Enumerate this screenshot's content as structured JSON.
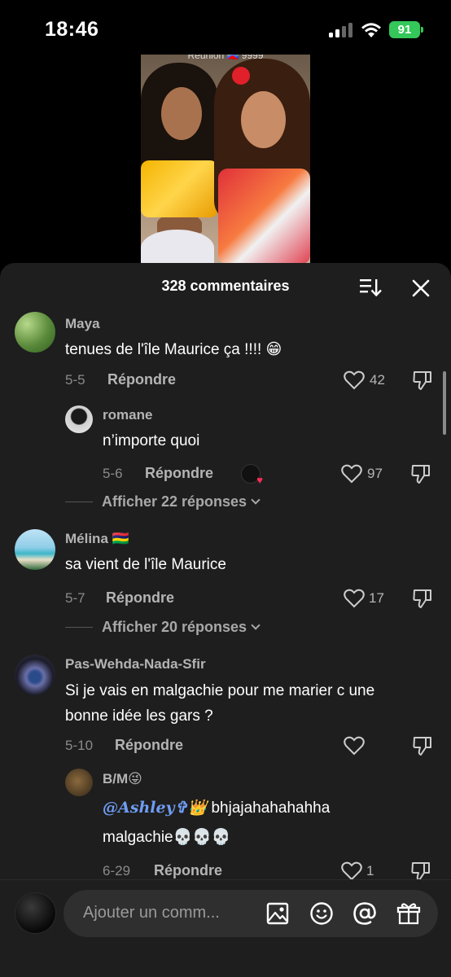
{
  "status": {
    "time": "18:46",
    "battery": "91"
  },
  "video": {
    "caption": "Réunion 🇷🇪 9999"
  },
  "sheet": {
    "title": "328 commentaires"
  },
  "comments": [
    {
      "name": "Maya",
      "text": "tenues de l'île Maurice ça !!!! 😁",
      "date": "5-5",
      "reply_label": "Répondre",
      "likes": "42"
    },
    {
      "name": "romane",
      "text": "n’importe quoi",
      "date": "5-6",
      "reply_label": "Répondre",
      "likes": "97"
    },
    {
      "more": "Afficher 22 réponses"
    },
    {
      "name": "Mélina 🇲🇺",
      "text": "sa vient de l'île Maurice",
      "date": "5-7",
      "reply_label": "Répondre",
      "likes": "17"
    },
    {
      "more": "Afficher 20 réponses"
    },
    {
      "name": "Pas-Wehda-Nada-Sfir",
      "text_line1": "Si je vais en malgachie pour me marier c une",
      "text_line2": "bonne idée les gars ?",
      "date": "5-10",
      "reply_label": "Répondre",
      "likes": ""
    },
    {
      "name": "B/M😜",
      "mention": "@Ashley✞👑",
      "text_line1": " bhjajahahahahha",
      "text_line2": "malgachie💀💀💀",
      "date": "6-29",
      "reply_label": "Répondre",
      "likes": "1"
    }
  ],
  "input": {
    "placeholder": "Ajouter un comm..."
  },
  "icons": [
    "signal-icon",
    "wifi-icon",
    "sort-icon",
    "close-icon",
    "heart-icon",
    "dislike-icon",
    "image-icon",
    "emoji-icon",
    "mention-icon",
    "gift-icon"
  ]
}
